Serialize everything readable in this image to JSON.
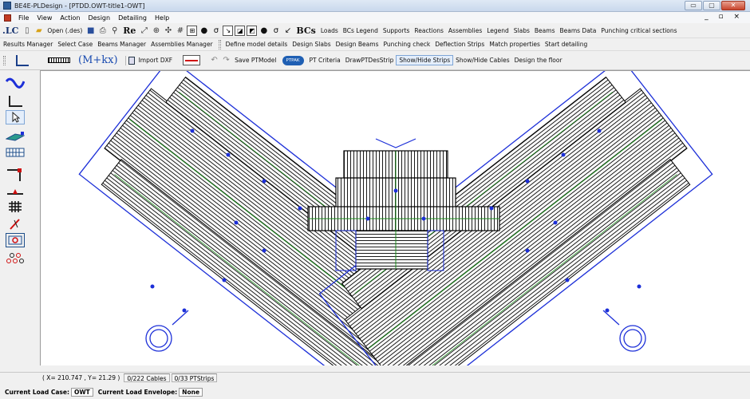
{
  "window": {
    "title": "BE4E-PLDesign - [PTDD.OWT-title1-OWT]",
    "controls": {
      "minimize": "▭",
      "maximize": "▢",
      "close": "✕"
    }
  },
  "menu": {
    "items": [
      "File",
      "View",
      "Action",
      "Design",
      "Detailing",
      "Help"
    ],
    "mdi_controls": "_ ▫ ×"
  },
  "toolbar1": {
    "lc_label": ".LC",
    "open_label": "Open (.des)",
    "re_label": "Re",
    "bcs_label": "BCs",
    "text_buttons": [
      "Loads",
      "BCs Legend",
      "Supports",
      "Reactions",
      "Assemblies",
      "Legend",
      "Slabs",
      "Beams",
      "Beams Data",
      "Punching critical sections"
    ]
  },
  "toolbar2": {
    "left_buttons": [
      "Results Manager",
      "Select Case",
      "Beams Manager",
      "Assemblies Manager"
    ],
    "right_buttons": [
      "Define model details",
      "Design Slabs",
      "Design Beams",
      "Punching check",
      "Deflection Strips",
      "Match properties",
      "Start detailing"
    ]
  },
  "toolbar3": {
    "mkx_label": "(M+kx)",
    "import_dxf": "Import DXF",
    "save_ptmodel": "Save PTModel",
    "ptpak": "PTPAK",
    "pt_criteria": "PT Criteria",
    "draw_ptdes_strip": "DrawPTDesStrip",
    "show_hide_strips": "Show/Hide Strips",
    "show_hide_cables": "Show/Hide Cables",
    "design_floor": "Design the floor"
  },
  "left_toolbar": {
    "icons": [
      "wave-tool-icon",
      "angle-tool-icon",
      "select-arrow-icon",
      "slab-tool-icon",
      "strip-grid-icon",
      "column-tool-icon",
      "support-tool-icon",
      "mesh-tool-icon",
      "pen-tool-icon",
      "punch-tool-icon",
      "nodes-tool-icon"
    ]
  },
  "status": {
    "coords": "( X= 210.747 , Y= 21.29 )",
    "cables": "0/222 Cables",
    "ptstrips": "0/33 PTStrips",
    "load_case_label": "Current Load Case:",
    "load_case_value": "OWT",
    "envelope_label": "Current Load Envelope:",
    "envelope_value": "None"
  },
  "colors": {
    "outline": "#1c2fd8",
    "hatch": "#000000",
    "green_strip": "#1a8a1a",
    "titlebar": "#dfe9f5"
  }
}
